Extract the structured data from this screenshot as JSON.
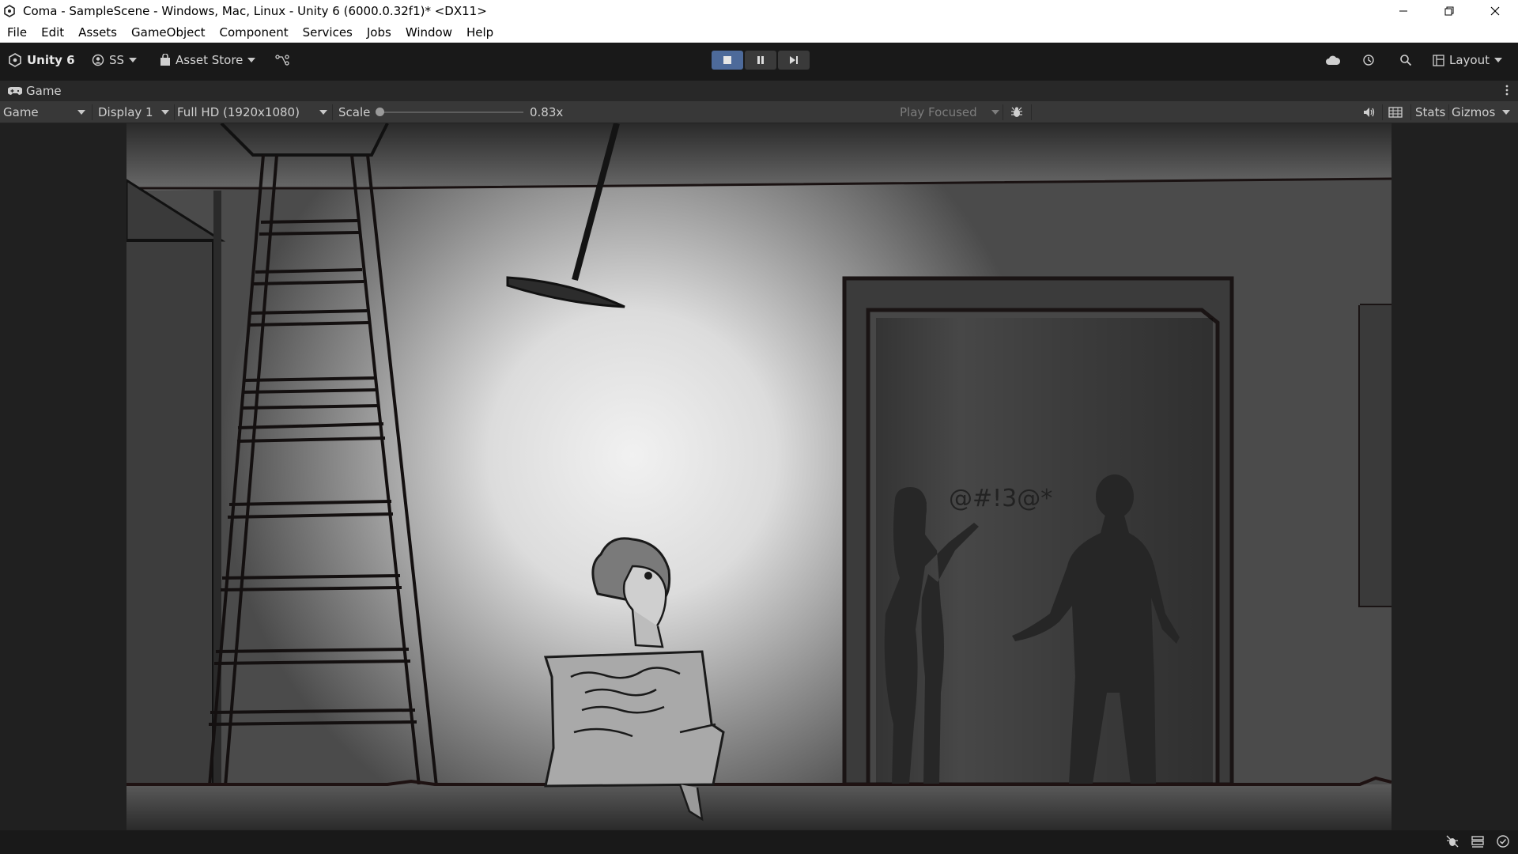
{
  "window": {
    "title": "Coma - SampleScene - Windows, Mac, Linux - Unity 6 (6000.0.32f1)* <DX11>"
  },
  "menu": {
    "items": [
      "File",
      "Edit",
      "Assets",
      "GameObject",
      "Component",
      "Services",
      "Jobs",
      "Window",
      "Help"
    ]
  },
  "toolbar": {
    "unity_label": "Unity 6",
    "account_label": "SS",
    "asset_store_label": "Asset Store",
    "layout_label": "Layout",
    "play_state": "playing"
  },
  "tab": {
    "label": "Game"
  },
  "gameview": {
    "mode": "Game",
    "display": "Display 1",
    "resolution": "Full HD (1920x1080)",
    "scale_label": "Scale",
    "scale_value": "0.83x",
    "scale_fraction": 0.0,
    "play_focused": "Play Focused",
    "stats_label": "Stats",
    "gizmos_label": "Gizmos"
  },
  "scene": {
    "speech_text": "@#!3@*"
  },
  "colors": {
    "title_bg": "#ffffff",
    "editor_bg": "#191919",
    "panel_bg": "#383838",
    "play_active": "#4d6a9a"
  }
}
